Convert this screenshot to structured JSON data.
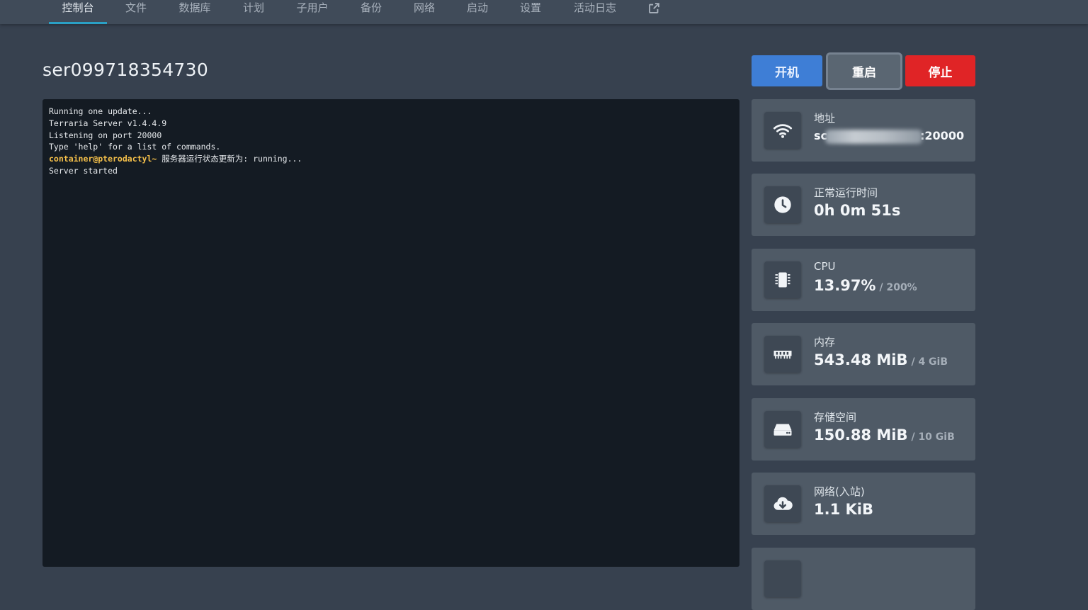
{
  "nav": {
    "tabs": [
      {
        "label": "控制台",
        "active": true
      },
      {
        "label": "文件"
      },
      {
        "label": "数据库"
      },
      {
        "label": "计划"
      },
      {
        "label": "子用户"
      },
      {
        "label": "备份"
      },
      {
        "label": "网络"
      },
      {
        "label": "启动"
      },
      {
        "label": "设置"
      },
      {
        "label": "活动日志"
      }
    ],
    "external_icon": "external-link-icon"
  },
  "server": {
    "name": "ser099718354730"
  },
  "power": {
    "start": "开机",
    "restart": "重启",
    "stop": "停止"
  },
  "console": {
    "lines": [
      "Running one update...",
      "Terraria Server v1.4.4.9",
      "Listening on port 20000",
      "Type 'help' for a list of commands."
    ],
    "prompt": "container@pterodactyl~",
    "status_message": " 服务器运行状态更新为: running...",
    "last_line": "Server started"
  },
  "stats": {
    "address": {
      "label": "地址",
      "prefix": "sc",
      "suffix": ":20000",
      "icon": "wifi-icon"
    },
    "uptime": {
      "label": "正常运行时间",
      "value": "0h 0m 51s",
      "icon": "clock-icon"
    },
    "cpu": {
      "label": "CPU",
      "value": "13.97%",
      "limit": "/ 200%",
      "icon": "chip-icon"
    },
    "memory": {
      "label": "内存",
      "value": "543.48 MiB",
      "limit": "/ 4 GiB",
      "icon": "memory-icon"
    },
    "storage": {
      "label": "存储空间",
      "value": "150.88 MiB",
      "limit": "/ 10 GiB",
      "icon": "hdd-icon"
    },
    "network_in": {
      "label": "网络(入站)",
      "value": "1.1 KiB",
      "icon": "cloud-download-icon"
    }
  },
  "colors": {
    "accent": "#2aa0c5",
    "start": "#3e7ed6",
    "stop": "#e02426",
    "prompt": "#f5c04a"
  }
}
